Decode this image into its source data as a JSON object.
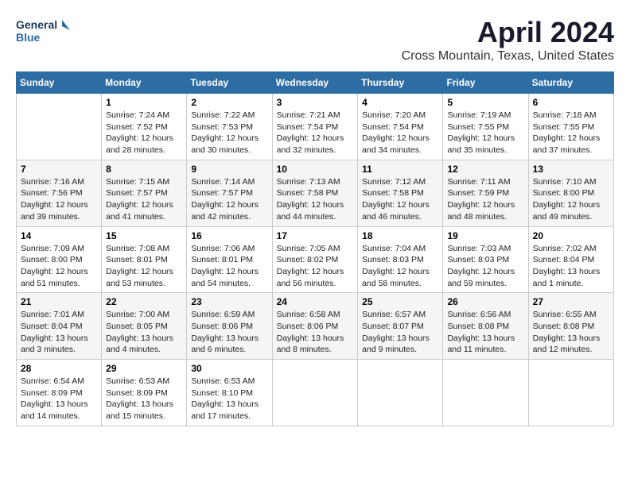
{
  "header": {
    "logo_line1": "General",
    "logo_line2": "Blue",
    "month_title": "April 2024",
    "location": "Cross Mountain, Texas, United States"
  },
  "weekdays": [
    "Sunday",
    "Monday",
    "Tuesday",
    "Wednesday",
    "Thursday",
    "Friday",
    "Saturday"
  ],
  "weeks": [
    [
      {
        "day": "",
        "info": ""
      },
      {
        "day": "1",
        "info": "Sunrise: 7:24 AM\nSunset: 7:52 PM\nDaylight: 12 hours\nand 28 minutes."
      },
      {
        "day": "2",
        "info": "Sunrise: 7:22 AM\nSunset: 7:53 PM\nDaylight: 12 hours\nand 30 minutes."
      },
      {
        "day": "3",
        "info": "Sunrise: 7:21 AM\nSunset: 7:54 PM\nDaylight: 12 hours\nand 32 minutes."
      },
      {
        "day": "4",
        "info": "Sunrise: 7:20 AM\nSunset: 7:54 PM\nDaylight: 12 hours\nand 34 minutes."
      },
      {
        "day": "5",
        "info": "Sunrise: 7:19 AM\nSunset: 7:55 PM\nDaylight: 12 hours\nand 35 minutes."
      },
      {
        "day": "6",
        "info": "Sunrise: 7:18 AM\nSunset: 7:55 PM\nDaylight: 12 hours\nand 37 minutes."
      }
    ],
    [
      {
        "day": "7",
        "info": "Sunrise: 7:16 AM\nSunset: 7:56 PM\nDaylight: 12 hours\nand 39 minutes."
      },
      {
        "day": "8",
        "info": "Sunrise: 7:15 AM\nSunset: 7:57 PM\nDaylight: 12 hours\nand 41 minutes."
      },
      {
        "day": "9",
        "info": "Sunrise: 7:14 AM\nSunset: 7:57 PM\nDaylight: 12 hours\nand 42 minutes."
      },
      {
        "day": "10",
        "info": "Sunrise: 7:13 AM\nSunset: 7:58 PM\nDaylight: 12 hours\nand 44 minutes."
      },
      {
        "day": "11",
        "info": "Sunrise: 7:12 AM\nSunset: 7:58 PM\nDaylight: 12 hours\nand 46 minutes."
      },
      {
        "day": "12",
        "info": "Sunrise: 7:11 AM\nSunset: 7:59 PM\nDaylight: 12 hours\nand 48 minutes."
      },
      {
        "day": "13",
        "info": "Sunrise: 7:10 AM\nSunset: 8:00 PM\nDaylight: 12 hours\nand 49 minutes."
      }
    ],
    [
      {
        "day": "14",
        "info": "Sunrise: 7:09 AM\nSunset: 8:00 PM\nDaylight: 12 hours\nand 51 minutes."
      },
      {
        "day": "15",
        "info": "Sunrise: 7:08 AM\nSunset: 8:01 PM\nDaylight: 12 hours\nand 53 minutes."
      },
      {
        "day": "16",
        "info": "Sunrise: 7:06 AM\nSunset: 8:01 PM\nDaylight: 12 hours\nand 54 minutes."
      },
      {
        "day": "17",
        "info": "Sunrise: 7:05 AM\nSunset: 8:02 PM\nDaylight: 12 hours\nand 56 minutes."
      },
      {
        "day": "18",
        "info": "Sunrise: 7:04 AM\nSunset: 8:03 PM\nDaylight: 12 hours\nand 58 minutes."
      },
      {
        "day": "19",
        "info": "Sunrise: 7:03 AM\nSunset: 8:03 PM\nDaylight: 12 hours\nand 59 minutes."
      },
      {
        "day": "20",
        "info": "Sunrise: 7:02 AM\nSunset: 8:04 PM\nDaylight: 13 hours\nand 1 minute."
      }
    ],
    [
      {
        "day": "21",
        "info": "Sunrise: 7:01 AM\nSunset: 8:04 PM\nDaylight: 13 hours\nand 3 minutes."
      },
      {
        "day": "22",
        "info": "Sunrise: 7:00 AM\nSunset: 8:05 PM\nDaylight: 13 hours\nand 4 minutes."
      },
      {
        "day": "23",
        "info": "Sunrise: 6:59 AM\nSunset: 8:06 PM\nDaylight: 13 hours\nand 6 minutes."
      },
      {
        "day": "24",
        "info": "Sunrise: 6:58 AM\nSunset: 8:06 PM\nDaylight: 13 hours\nand 8 minutes."
      },
      {
        "day": "25",
        "info": "Sunrise: 6:57 AM\nSunset: 8:07 PM\nDaylight: 13 hours\nand 9 minutes."
      },
      {
        "day": "26",
        "info": "Sunrise: 6:56 AM\nSunset: 8:08 PM\nDaylight: 13 hours\nand 11 minutes."
      },
      {
        "day": "27",
        "info": "Sunrise: 6:55 AM\nSunset: 8:08 PM\nDaylight: 13 hours\nand 12 minutes."
      }
    ],
    [
      {
        "day": "28",
        "info": "Sunrise: 6:54 AM\nSunset: 8:09 PM\nDaylight: 13 hours\nand 14 minutes."
      },
      {
        "day": "29",
        "info": "Sunrise: 6:53 AM\nSunset: 8:09 PM\nDaylight: 13 hours\nand 15 minutes."
      },
      {
        "day": "30",
        "info": "Sunrise: 6:53 AM\nSunset: 8:10 PM\nDaylight: 13 hours\nand 17 minutes."
      },
      {
        "day": "",
        "info": ""
      },
      {
        "day": "",
        "info": ""
      },
      {
        "day": "",
        "info": ""
      },
      {
        "day": "",
        "info": ""
      }
    ]
  ]
}
